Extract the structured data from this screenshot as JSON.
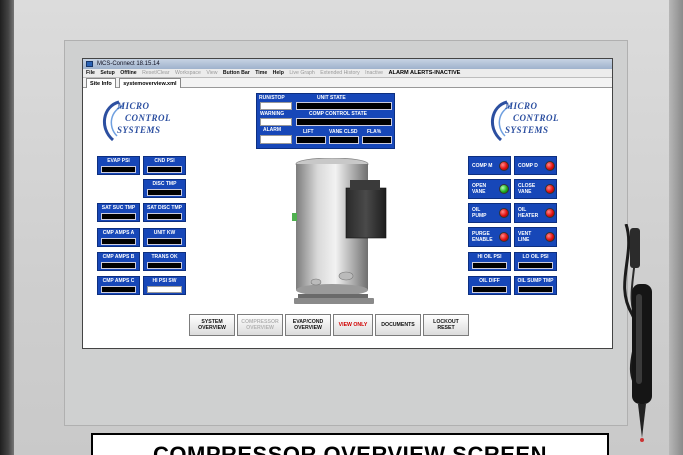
{
  "window": {
    "title": "MCS-Connect 18.15.14"
  },
  "menu": {
    "items": [
      "File",
      "Setup",
      "Offline",
      "Reset/Clear",
      "Workspace",
      "View",
      "Button Bar",
      "Time",
      "Help",
      "Live Graph",
      "Extended History",
      "Inactive"
    ],
    "dim_items": [
      "Reset/Clear",
      "Workspace",
      "View",
      "Live Graph",
      "Extended History",
      "Inactive"
    ],
    "alarm_status": "ALARM ALERTS-INACTIVE"
  },
  "tabs": {
    "site_info": "Site Info",
    "file": "systemoverview.xml"
  },
  "logo": {
    "line1": "MICRO",
    "line2": "CONTROL",
    "line3": "SYSTEMS"
  },
  "state_panel": {
    "run_stop": "RUN/STOP",
    "unit_state": "UNIT STATE",
    "warning": "WARNING",
    "comp_control_state": "COMP CONTROL STATE",
    "alarm": "ALARM",
    "lift": "LIFT",
    "vane_clsd": "VANE CLSD",
    "fla": "FLA%"
  },
  "left_panels": {
    "evap_psi": "EVAP PSI",
    "cnd_psi": "CND PSI",
    "disc_tmp": "DISC TMP",
    "sat_suc_tmp": "SAT SUC TMP",
    "sat_disc_tmp": "SAT DISC TMP",
    "cmp_amps_a": "CMP AMPS A",
    "unit_kw": "UNIT KW",
    "cmp_amps_b": "CMP AMPS B",
    "trans_ok": "TRANS OK",
    "cmp_amps_c": "CMP AMPS C",
    "hi_psi_sw": "HI PSI SW"
  },
  "right_panels": {
    "comp_m": "COMP M",
    "comp_d": "COMP D",
    "open_vane": "OPEN VANE",
    "close_vane": "CLOSE VANE",
    "oil_pump": "OIL PUMP",
    "oil_heater": "OIL HEATER",
    "purge_enable": "PURGE ENABLE",
    "vent_line": "VENT LINE",
    "hi_oil_psi": "HI OIL PSI",
    "lo_oil_psi": "LO OIL PSI",
    "oil_diff": "OIL DIFF",
    "oil_sump_tmp": "OIL SUMP TMP"
  },
  "leds": {
    "comp_m": "red",
    "comp_d": "red",
    "open_vane": "green",
    "close_vane": "red",
    "oil_pump": "red",
    "oil_heater": "red",
    "purge_enable": "red",
    "vent_line": "red"
  },
  "nav_buttons": {
    "system_overview": "SYSTEM OVERVIEW",
    "compressor_overview": "COMPRESSOR OVERVIEW",
    "evap_cond_overview": "EVAP/COND OVERVIEW",
    "view_only": "VIEW ONLY",
    "documents": "DOCUMENTS",
    "lockout_reset": "LOCKOUT RESET"
  },
  "caption": "COMPRESSOR OVERVIEW SCREEN",
  "colors": {
    "panel_blue": "#1747b8",
    "led_red": "#e01010",
    "led_green": "#1fae1f",
    "logo_blue": "#2c4fa0"
  },
  "icons": [
    "app-icon",
    "compressor-image",
    "stylus-pen"
  ]
}
